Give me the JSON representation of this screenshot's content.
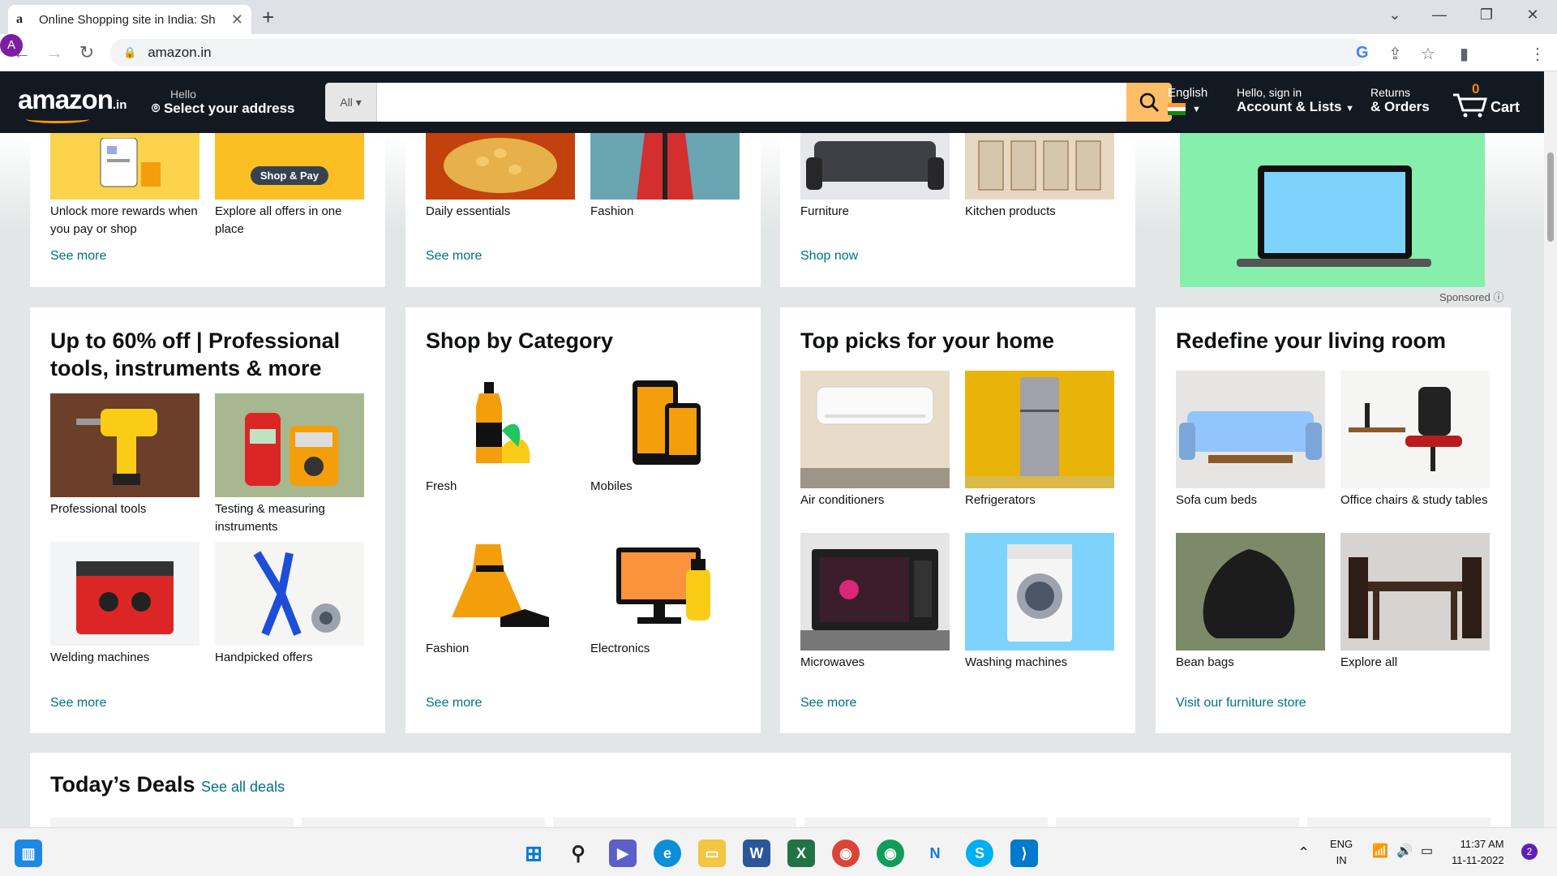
{
  "browser": {
    "tab_title": "Online Shopping site in India: Sh",
    "tab_favicon": "a",
    "url": "amazon.in",
    "profile_initial": "A"
  },
  "header": {
    "logo_text": "amazon",
    "logo_suffix": ".in",
    "address_small": "Hello",
    "address_big": "Select your address",
    "search_category": "All",
    "search_placeholder": "",
    "language": "English",
    "account_small": "Hello, sign in",
    "account_big": "Account & Lists",
    "orders_small": "Returns",
    "orders_big": "& Orders",
    "cart_count": "0",
    "cart_label": "Cart"
  },
  "row1": {
    "card1": {
      "tiles": [
        "Unlock more rewards when you pay or shop",
        "Explore all offers in one place"
      ],
      "link": "See more",
      "badge": "Shop & Pay"
    },
    "card2": {
      "tiles": [
        "Daily essentials",
        "Fashion"
      ],
      "link": "See more"
    },
    "card3": {
      "tiles": [
        "Furniture",
        "Kitchen products"
      ],
      "link": "Shop now"
    },
    "ad": {
      "sponsored": "Sponsored"
    }
  },
  "row2": {
    "card1": {
      "title": "Up to 60% off | Professional tools, instruments & more",
      "tiles": [
        "Professional tools",
        "Testing & measuring instruments",
        "Welding machines",
        "Handpicked offers"
      ],
      "link": "See more"
    },
    "card2": {
      "title": "Shop by Category",
      "tiles": [
        "Fresh",
        "Mobiles",
        "Fashion",
        "Electronics"
      ],
      "link": "See more"
    },
    "card3": {
      "title": "Top picks for your home",
      "tiles": [
        "Air conditioners",
        "Refrigerators",
        "Microwaves",
        "Washing machines"
      ],
      "link": "See more"
    },
    "card4": {
      "title": "Redefine your living room",
      "tiles": [
        "Sofa cum beds",
        "Office chairs & study tables",
        "Bean bags",
        "Explore all"
      ],
      "link": "Visit our furniture store"
    }
  },
  "deals": {
    "title": "Today’s Deals",
    "link": "See all deals"
  },
  "taskbar": {
    "lang1": "ENG",
    "lang2": "IN",
    "time": "11:37 AM",
    "date": "11-11-2022",
    "notif_count": "2"
  },
  "colors": {
    "header_bg": "#131921",
    "accent": "#febd69",
    "link": "#007185"
  }
}
